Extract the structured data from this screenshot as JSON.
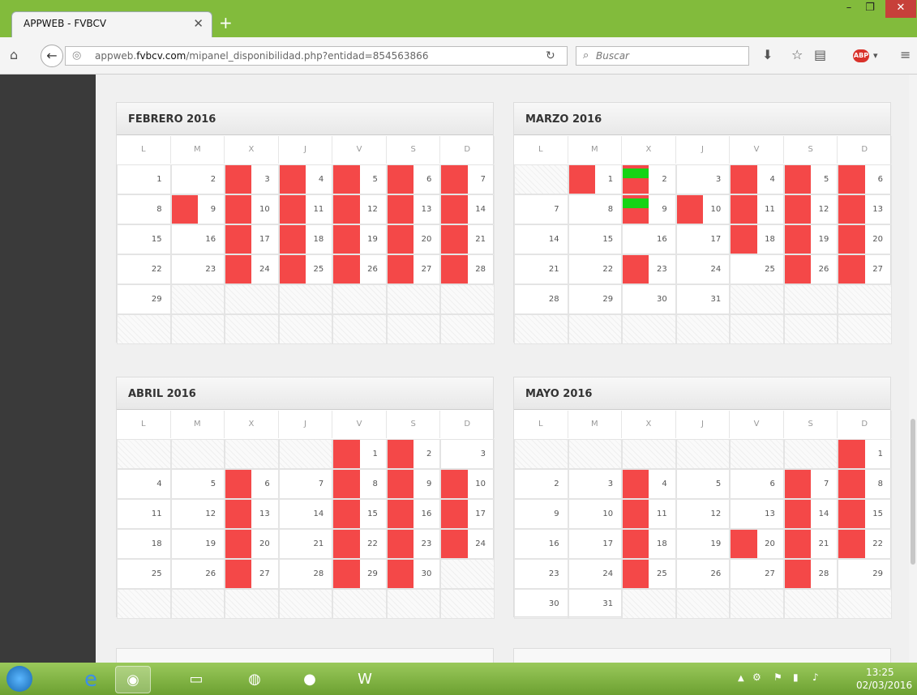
{
  "browser": {
    "tab_title": "APPWEB - FVBCV",
    "url_prefix": "appweb.",
    "url_domain": "fvbcv.com",
    "url_path": "/mipanel_disponibilidad.php?entidad=854563866",
    "search_placeholder": "Buscar",
    "addon_label": "ABP"
  },
  "calendar": {
    "weekdays": [
      "L",
      "M",
      "X",
      "J",
      "V",
      "S",
      "D"
    ],
    "months": [
      {
        "title": "FEBRERO 2016",
        "start": 0,
        "days": 29,
        "busy": [
          3,
          4,
          5,
          6,
          7,
          9,
          10,
          11,
          12,
          13,
          14,
          17,
          18,
          19,
          20,
          21,
          24,
          25,
          26,
          27,
          28
        ],
        "free": []
      },
      {
        "title": "MARZO 2016",
        "start": 1,
        "days": 31,
        "busy": [
          1,
          2,
          4,
          5,
          6,
          9,
          10,
          11,
          12,
          13,
          18,
          19,
          20,
          23,
          26,
          27
        ],
        "free": [
          2,
          9
        ]
      },
      {
        "title": "ABRIL 2016",
        "start": 4,
        "days": 30,
        "busy": [
          1,
          2,
          6,
          8,
          9,
          10,
          13,
          15,
          16,
          17,
          20,
          22,
          23,
          24,
          27,
          29,
          30
        ],
        "free": []
      },
      {
        "title": "MAYO 2016",
        "start": 6,
        "days": 31,
        "busy": [
          1,
          4,
          7,
          8,
          11,
          14,
          15,
          18,
          20,
          21,
          22,
          25,
          28
        ],
        "free": []
      }
    ]
  },
  "taskbar": {
    "time": "13:25",
    "date": "02/03/2016"
  }
}
